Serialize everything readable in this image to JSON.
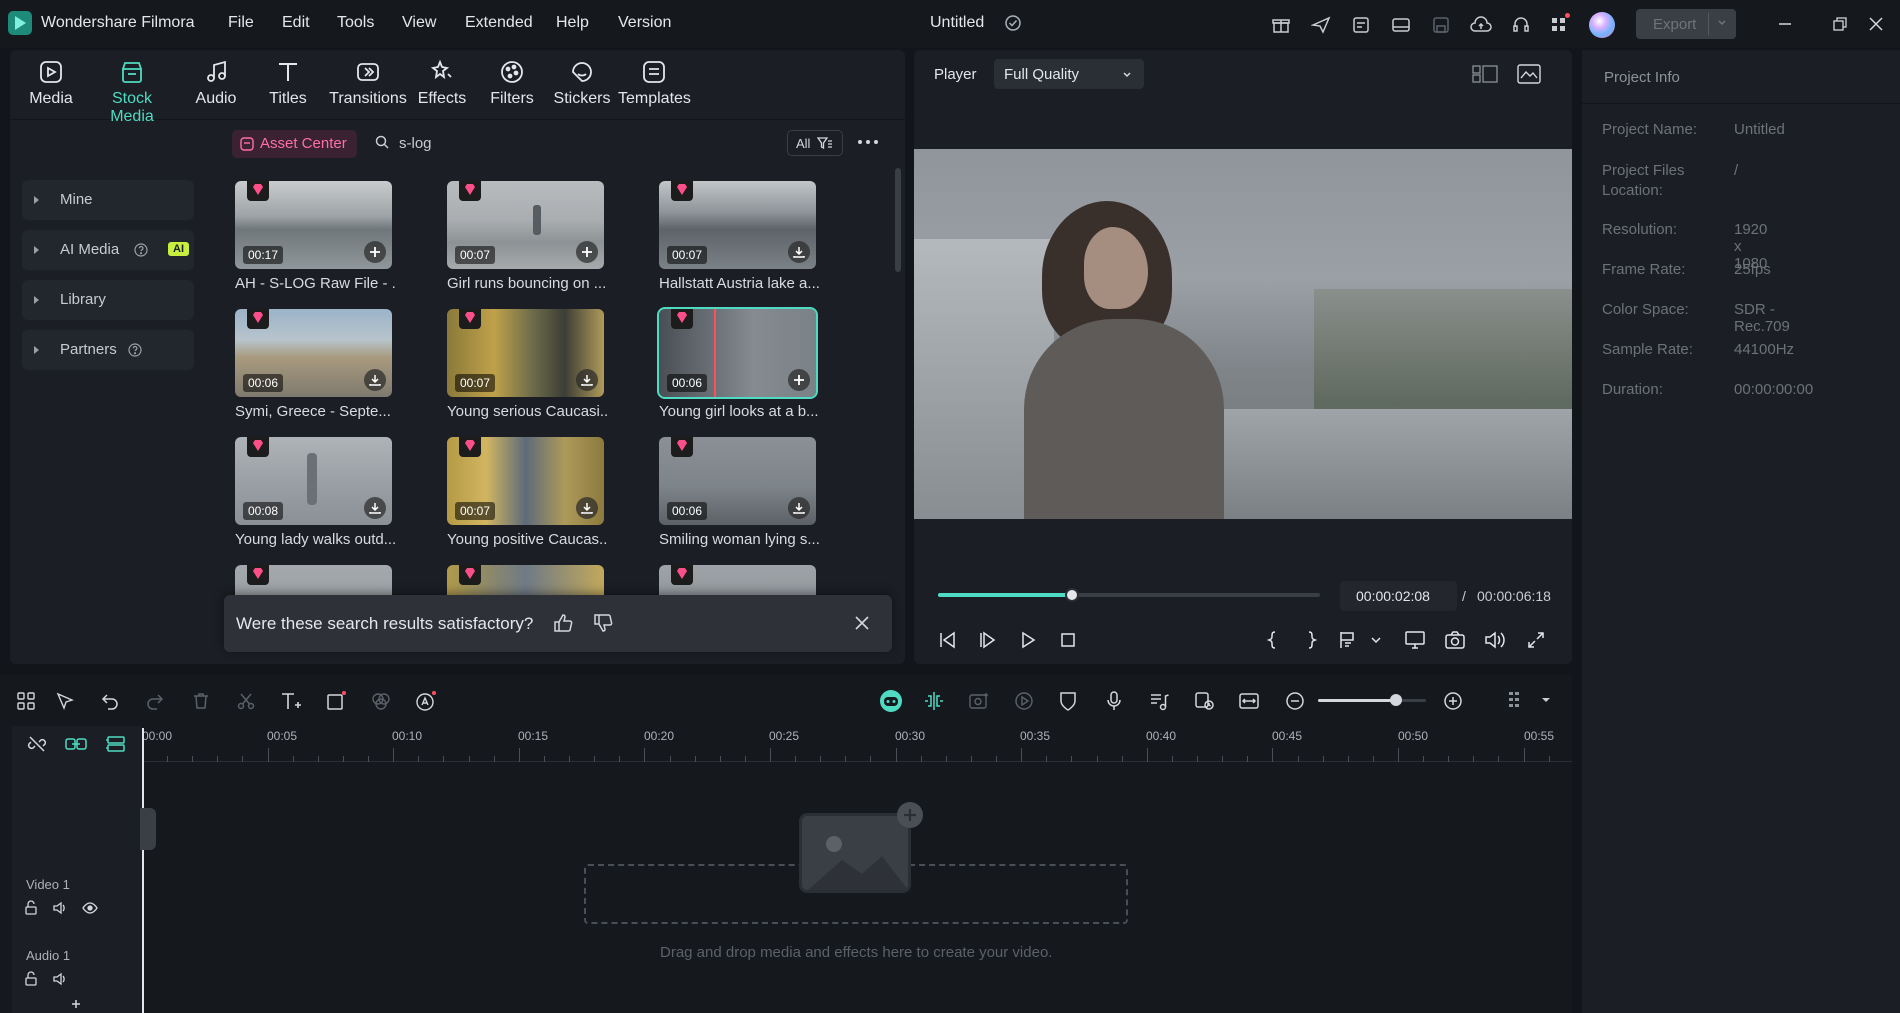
{
  "app": {
    "name": "Wondershare Filmora",
    "title": "Untitled",
    "export_label": "Export"
  },
  "menu": [
    "File",
    "Edit",
    "Tools",
    "View",
    "Extended",
    "Help",
    "Version"
  ],
  "tabs": [
    {
      "label": "Media",
      "icon": "media-icon"
    },
    {
      "label": "Stock Media",
      "icon": "stock-media-icon",
      "active": true
    },
    {
      "label": "Audio",
      "icon": "audio-icon"
    },
    {
      "label": "Titles",
      "icon": "titles-icon"
    },
    {
      "label": "Transitions",
      "icon": "transitions-icon"
    },
    {
      "label": "Effects",
      "icon": "effects-icon"
    },
    {
      "label": "Filters",
      "icon": "filters-icon"
    },
    {
      "label": "Stickers",
      "icon": "stickers-icon"
    },
    {
      "label": "Templates",
      "icon": "templates-icon"
    }
  ],
  "sidebar": [
    {
      "label": "Mine"
    },
    {
      "label": "AI Media",
      "badge": "AI"
    },
    {
      "label": "Library"
    },
    {
      "label": "Partners"
    }
  ],
  "search": {
    "asset_center": "Asset Center",
    "query": "s-log",
    "filter": "All"
  },
  "assets": [
    {
      "title": "AH - S-LOG Raw File - ...",
      "duration": "00:17",
      "action": "add"
    },
    {
      "title": "Girl runs bouncing on ...",
      "duration": "00:07",
      "action": "add"
    },
    {
      "title": "Hallstatt Austria lake a...",
      "duration": "00:07",
      "action": "download"
    },
    {
      "title": "Symi, Greece - Septe...",
      "duration": "00:06",
      "action": "download"
    },
    {
      "title": "Young serious Caucasi...",
      "duration": "00:07",
      "action": "download"
    },
    {
      "title": "Young girl looks at a b...",
      "duration": "00:06",
      "action": "add",
      "selected": true
    },
    {
      "title": "Young lady walks outd...",
      "duration": "00:08",
      "action": "download"
    },
    {
      "title": "Young positive Caucas...",
      "duration": "00:07",
      "action": "download"
    },
    {
      "title": "Smiling woman lying s...",
      "duration": "00:06",
      "action": "download"
    }
  ],
  "feedback": {
    "question": "Were these search results satisfactory?"
  },
  "player": {
    "label": "Player",
    "quality": "Full Quality",
    "current_time": "00:00:02:08",
    "separator": "/",
    "total_time": "00:00:06:18",
    "progress": 0.35
  },
  "project_info": {
    "heading": "Project Info",
    "rows": [
      {
        "key": "Project Name:",
        "value": "Untitled"
      },
      {
        "key": "Project Files Location:",
        "value": "/"
      },
      {
        "key": "Resolution:",
        "value": "1920 x 1080"
      },
      {
        "key": "Frame Rate:",
        "value": "25fps"
      },
      {
        "key": "Color Space:",
        "value": "SDR - Rec.709"
      },
      {
        "key": "Sample Rate:",
        "value": "44100Hz"
      },
      {
        "key": "Duration:",
        "value": "00:00:00:00"
      }
    ]
  },
  "timeline": {
    "ruler": [
      "00:00",
      "00:05",
      "00:10",
      "00:15",
      "00:20",
      "00:25",
      "00:30",
      "00:35",
      "00:40",
      "00:45",
      "00:50",
      "00:55"
    ],
    "tracks": [
      {
        "label": "Video 1"
      },
      {
        "label": "Audio 1"
      }
    ],
    "drop_hint": "Drag and drop media and effects here to create your video.",
    "zoom": 0.72
  },
  "colors": {
    "accent": "#4fdbc2",
    "pink": "#ff4f8b",
    "bg": "#121519",
    "panel": "#1b1e24"
  }
}
